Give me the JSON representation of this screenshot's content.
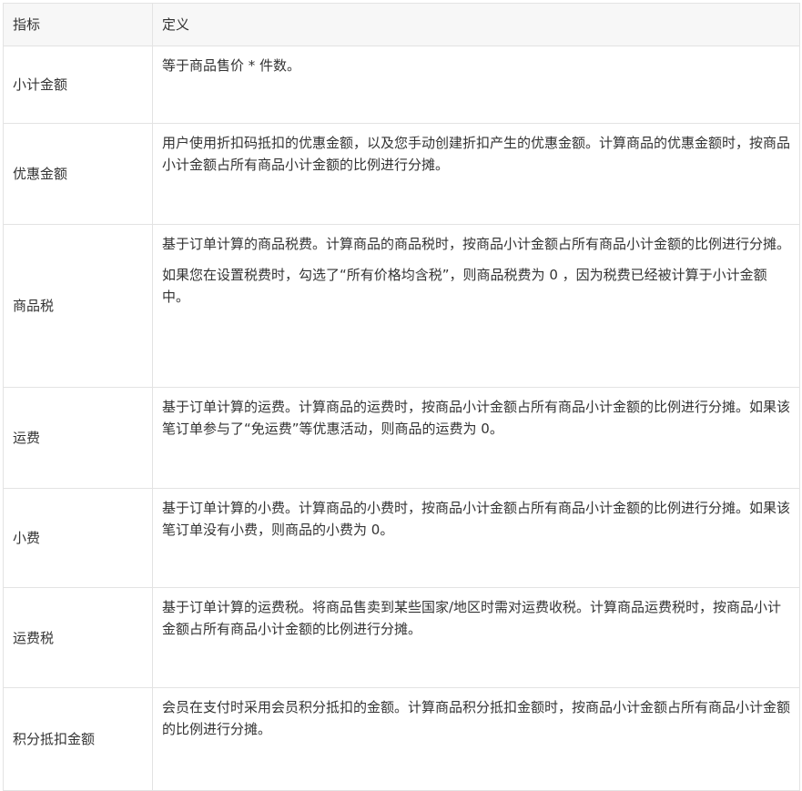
{
  "table": {
    "headers": {
      "metric": "指标",
      "definition": "定义"
    },
    "rows": [
      {
        "name": "小计金额",
        "paragraphs": [
          "等于商品售价 * 件数。"
        ]
      },
      {
        "name": "优惠金额",
        "paragraphs": [
          "用户使用折扣码抵扣的优惠金额，以及您手动创建折扣产生的优惠金额。计算商品的优惠金额时，按商品小计金额占所有商品小计金额的比例进行分摊。"
        ]
      },
      {
        "name": "商品税",
        "paragraphs": [
          "基于订单计算的商品税费。计算商品的商品税时，按商品小计金额占所有商品小计金额的比例进行分摊。",
          "如果您在设置税费时，勾选了“所有价格均含税”，则商品税费为 0 ，因为税费已经被计算于小计金额中。"
        ]
      },
      {
        "name": "运费",
        "paragraphs": [
          "基于订单计算的运费。计算商品的运费时，按商品小计金额占所有商品小计金额的比例进行分摊。如果该笔订单参与了“免运费”等优惠活动，则商品的运费为 0。"
        ]
      },
      {
        "name": "小费",
        "paragraphs": [
          "基于订单计算的小费。计算商品的小费时，按商品小计金额占所有商品小计金额的比例进行分摊。如果该笔订单没有小费，则商品的小费为 0。"
        ]
      },
      {
        "name": "运费税",
        "paragraphs": [
          "基于订单计算的运费税。将商品售卖到某些国家/地区时需对运费收税。计算商品运费税时，按商品小计金额占所有商品小计金额的比例进行分摊。"
        ]
      },
      {
        "name": "积分抵扣金额",
        "paragraphs": [
          "会员在支付时采用会员积分抵扣的金额。计算商品积分抵扣金额时，按商品小计金额占所有商品小计金额的比例进行分摊。"
        ]
      }
    ]
  }
}
